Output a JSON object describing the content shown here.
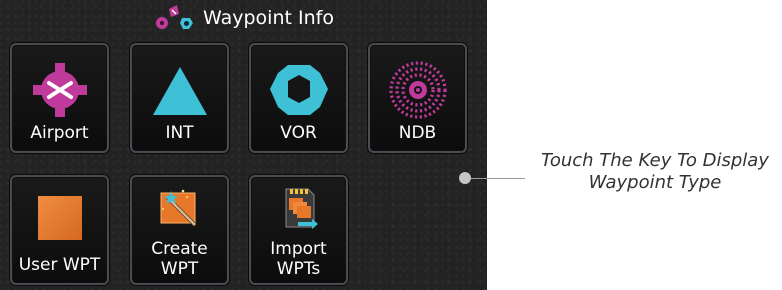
{
  "header": {
    "title": "Waypoint Info",
    "icon": "waypoint-icon"
  },
  "keys": [
    {
      "label": "Airport",
      "icon": "airport-icon"
    },
    {
      "label": "INT",
      "icon": "intersection-icon"
    },
    {
      "label": "VOR",
      "icon": "vor-icon"
    },
    {
      "label": "NDB",
      "icon": "ndb-icon"
    },
    {
      "label_line1": "User WPT",
      "icon": "user-waypoint-icon"
    },
    {
      "label_line1": "Create",
      "label_line2": "WPT",
      "icon": "create-waypoint-icon"
    },
    {
      "label_line1": "Import",
      "label_line2": "WPTs",
      "icon": "import-waypoints-icon"
    }
  ],
  "callout": {
    "line1": "Touch The Key To Display",
    "line2": "Waypoint Type"
  },
  "colors": {
    "airport": "#c03a9b",
    "int": "#3ec0d6",
    "vor": "#3ec0d6",
    "ndb": "#c03a9b",
    "user_wpt": "#e7782a"
  }
}
